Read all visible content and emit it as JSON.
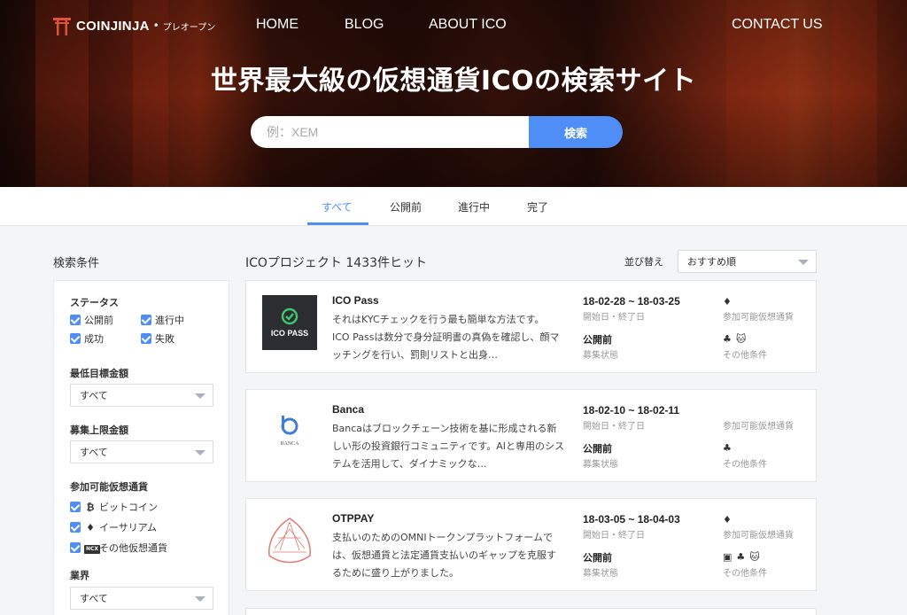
{
  "header": {
    "brand": "COINJINJA",
    "brand_sub": "プレオープン",
    "nav": [
      "HOME",
      "BLOG",
      "ABOUT ICO",
      "CONTACT US"
    ],
    "title": "世界最大級の仮想通貨ICOの検索サイト",
    "search_placeholder": "例：XEM",
    "search_button": "検索"
  },
  "tabs": [
    "すべて",
    "公開前",
    "進行中",
    "完了"
  ],
  "active_tab": "すべて",
  "sidebar": {
    "title": "検索条件",
    "status_label": "ステータス",
    "status_options": [
      "公開前",
      "進行中",
      "成功",
      "失敗"
    ],
    "min_target_label": "最低目標金額",
    "min_target_value": "すべて",
    "max_cap_label": "募集上限金額",
    "max_cap_value": "すべて",
    "currency_label": "参加可能仮想通貨",
    "currency_options": [
      {
        "icon": "bitcoin-icon",
        "glyph": "₿",
        "label": "ビットコイン"
      },
      {
        "icon": "ethereum-icon",
        "glyph": "♦",
        "label": "イーサリアム"
      },
      {
        "icon": "ncx-icon",
        "glyph": "NCX",
        "label": "その他仮想通貨"
      }
    ],
    "industry_label": "業界",
    "industry_value": "すべて"
  },
  "main": {
    "hits": "ICOプロジェクト 1433件ヒット",
    "sort_label": "並び替え",
    "sort_value": "おすすめ順",
    "period_label": "開始日・終了日",
    "status_caption": "募集状態",
    "currency_caption": "参加可能仮想通貨",
    "other_caption": "その他条件",
    "projects": [
      {
        "name": "ICO Pass",
        "logo_text": "ICO PASS",
        "desc": "それはKYCチェックを行う最も簡単な方法です。 ICO Passは数分で身分証明書の真偽を確認し、顔マッチングを行い、罰則リストと出身…",
        "dates": "18-02-28 ~ 18-03-25",
        "status": "公開前",
        "currencies": "♦",
        "others": [
          "♣",
          "🐱"
        ]
      },
      {
        "name": "Banca",
        "logo_text": "BANCA",
        "desc": "Bancaはブロックチェーン技術を基に形成される新しい形の投資銀行コミュニティです。AIと専用のシステムを活用して、ダイナミックな…",
        "dates": "18-02-10 ~ 18-02-11",
        "status": "公開前",
        "currencies": "",
        "others": [
          "♣"
        ]
      },
      {
        "name": "OTPPAY",
        "logo_text": "",
        "desc": "支払いのためのOMNIトークンプラットフォームでは、仮想通貨と法定通貨支払いのギャップを克服するために盛り上がりました。",
        "dates": "18-03-05 ~ 18-04-03",
        "status": "公開前",
        "currencies": "♦",
        "others": [
          "▣",
          "♣",
          "🐱"
        ]
      }
    ]
  },
  "colors": {
    "accent": "#4f8ef7",
    "hero": "#5c1a0e"
  }
}
